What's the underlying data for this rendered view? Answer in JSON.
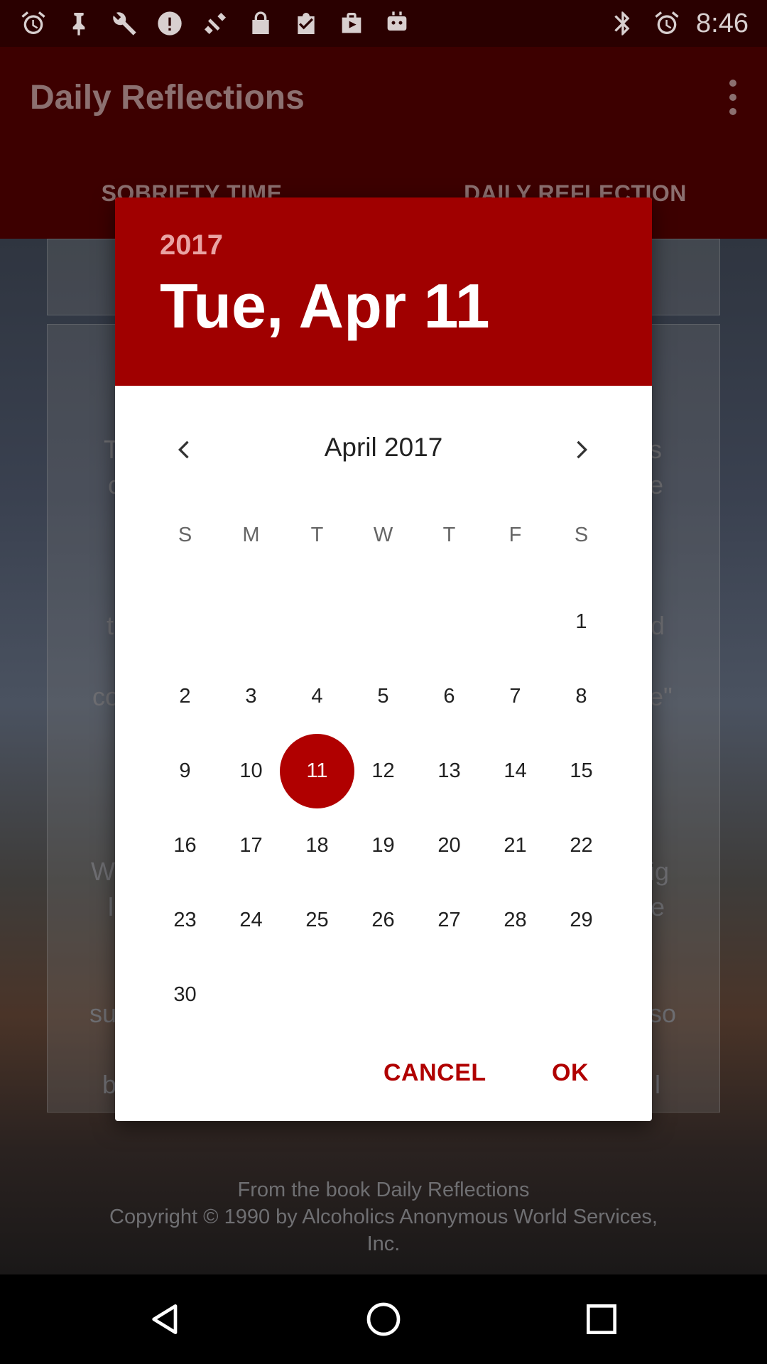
{
  "status_bar": {
    "time": "8:46",
    "icons_left": [
      "alarm-icon",
      "pin-icon",
      "wrench-icon",
      "blocked-icon",
      "fake-gps-icon",
      "lock-icon",
      "task-icon",
      "briefcase-icon",
      "robot-icon"
    ],
    "icons_right": [
      "bluetooth-icon",
      "alarm-icon"
    ]
  },
  "app_bar": {
    "title": "Daily Reflections"
  },
  "tabs": [
    {
      "label": "SOBRIETY TIME"
    },
    {
      "label": "DAILY REFLECTION"
    }
  ],
  "background": {
    "fragments": [
      {
        "text": "T"
      },
      {
        "text": "s"
      },
      {
        "text": "c"
      },
      {
        "text": "e"
      },
      {
        "text": "t"
      },
      {
        "text": "d"
      },
      {
        "text": "co"
      },
      {
        "text": "e\""
      },
      {
        "text": "W"
      },
      {
        "text": "ig"
      },
      {
        "text": "l"
      },
      {
        "text": "e"
      },
      {
        "text": "su"
      },
      {
        "text": "so"
      },
      {
        "text": "b"
      },
      {
        "text": "l"
      }
    ],
    "footer_line1": "From the book Daily Reflections",
    "footer_line2": "Copyright © 1990 by Alcoholics Anonymous World Services,",
    "footer_line3": "Inc."
  },
  "dialog": {
    "year": "2017",
    "selected_date": "Tue, Apr 11",
    "month_label": "April 2017",
    "weekdays": [
      "S",
      "M",
      "T",
      "W",
      "T",
      "F",
      "S"
    ],
    "weeks": [
      [
        "",
        "",
        "",
        "",
        "",
        "",
        "1"
      ],
      [
        "2",
        "3",
        "4",
        "5",
        "6",
        "7",
        "8"
      ],
      [
        "9",
        "10",
        "11",
        "12",
        "13",
        "14",
        "15"
      ],
      [
        "16",
        "17",
        "18",
        "19",
        "20",
        "21",
        "22"
      ],
      [
        "23",
        "24",
        "25",
        "26",
        "27",
        "28",
        "29"
      ],
      [
        "30",
        "",
        "",
        "",
        "",
        "",
        ""
      ]
    ],
    "selected_day": "11",
    "cancel_label": "CANCEL",
    "ok_label": "OK",
    "accent_color": "#a00000"
  },
  "nav_bar": {
    "buttons": [
      "back-icon",
      "home-icon",
      "recents-icon"
    ]
  }
}
